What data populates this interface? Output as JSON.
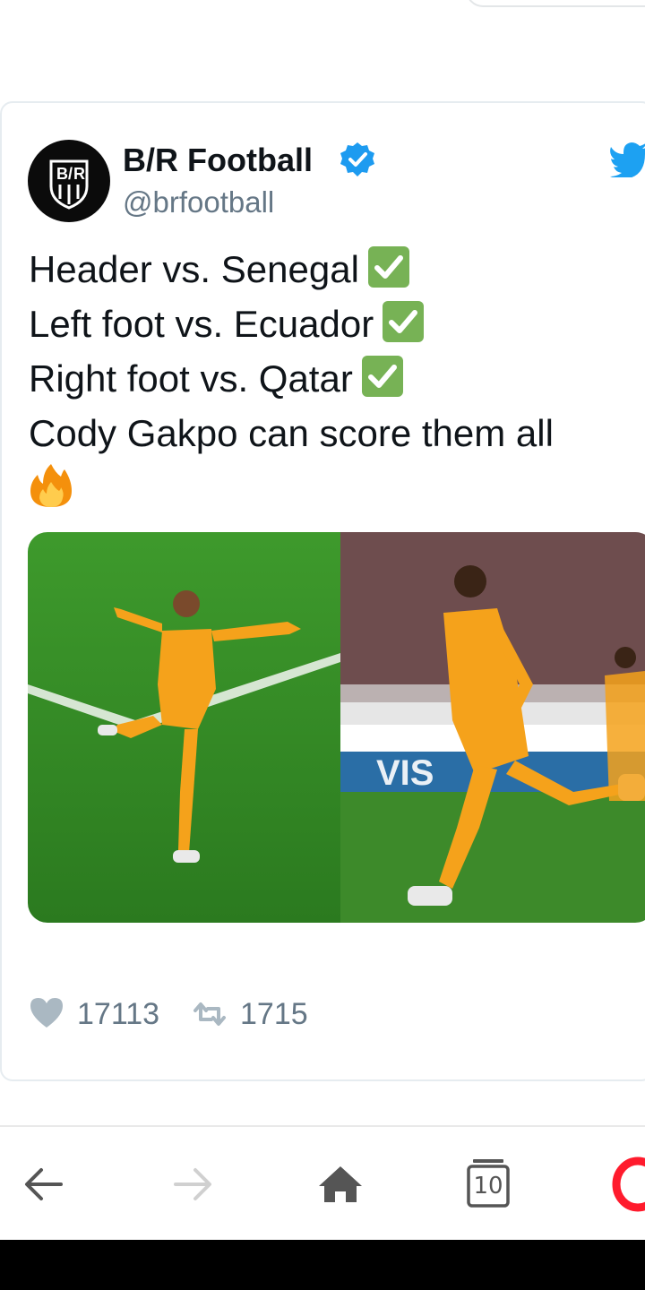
{
  "tweet": {
    "display_name": "B/R Football",
    "handle": "@brfootball",
    "text_lines": [
      "Header vs. Senegal",
      "Left foot vs. Ecuador",
      "Right foot vs. Qatar",
      "Cody Gakpo can score them all"
    ],
    "likes": "17113",
    "retweets": "1715"
  },
  "browser": {
    "tab_count": "10"
  },
  "icons": [
    "verified-badge-icon",
    "twitter-bird-icon",
    "check-mark-icon",
    "fire-icon",
    "heart-icon",
    "retweet-icon",
    "back-arrow-icon",
    "forward-arrow-icon",
    "home-icon",
    "tabs-icon",
    "opera-logo-icon"
  ],
  "colors": {
    "verified_blue": "#1d9bf0",
    "twitter_blue": "#1da1f2",
    "check_green": "#77b255",
    "stats_gray": "#657786",
    "opera_red": "#ff1b2d"
  }
}
